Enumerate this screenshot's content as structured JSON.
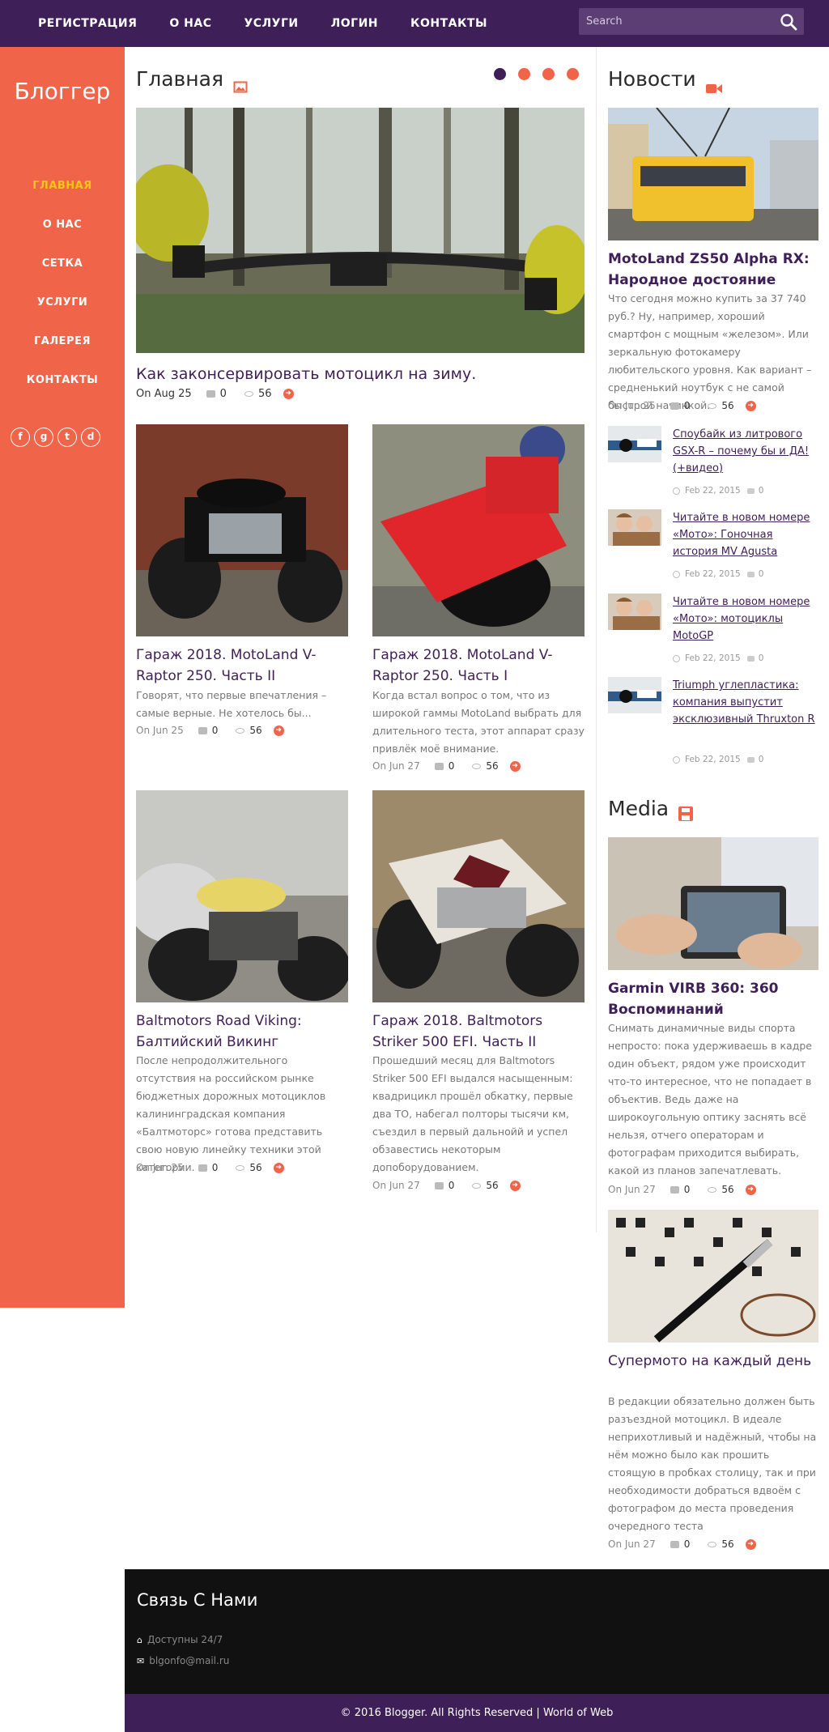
{
  "topnav": {
    "items": [
      {
        "label": "РЕГИСТРАЦИЯ"
      },
      {
        "label": "О НАС"
      },
      {
        "label": "УСЛУГИ"
      },
      {
        "label": "ЛОГИН"
      },
      {
        "label": "КОНТАКТЫ"
      }
    ],
    "search_placeholder": "Search"
  },
  "sidebar": {
    "logo": "Блоггер",
    "items": [
      {
        "label": "ГЛАВНАЯ"
      },
      {
        "label": "О НАС"
      },
      {
        "label": "СЕТКА"
      },
      {
        "label": "УСЛУГИ"
      },
      {
        "label": "ГАЛЕРЕЯ"
      },
      {
        "label": "КОНТАКТЫ"
      }
    ],
    "social": [
      "f",
      "g",
      "t",
      "d"
    ]
  },
  "main": {
    "title": "Главная",
    "featured": {
      "title": "Как законсервировать мотоцикл на зиму.",
      "date": "On Aug 25",
      "comments": "0",
      "views": "56"
    },
    "posts": [
      {
        "title": "Гараж 2018. MotoLand V-Raptor 250. Часть II",
        "excerpt": "Говорят, что первые впечатления – самые верные. Не хотелось бы...",
        "date": "On Jun 25",
        "comments": "0",
        "views": "56"
      },
      {
        "title": "Гараж 2018. MotoLand V-Raptor 250. Часть I",
        "excerpt": "Когда встал вопрос о том, что из широкой гаммы MotoLand выбрать для длительного теста, этот аппарат сразу привлёк моё внимание.",
        "date": "On Jun 27",
        "comments": "0",
        "views": "56"
      },
      {
        "title": "Baltmotors Road Viking: Балтийский Викинг",
        "excerpt": "После непродолжительного отсутствия на российском рынке бюджетных дорожных мотоциклов калининградская компания «Балтмоторс» готова представить свою новую линейку техники этой категории.",
        "date": "On Jun 25",
        "comments": "0",
        "views": "56"
      },
      {
        "title": "Гараж 2018. Baltmotors Striker 500 EFI. Часть II",
        "excerpt": "Прошедший месяц для Baltmotors Striker 500 EFI выдался насыщенным: квадрицикл прошёл обкатку, первые два ТО, набегал полторы тысячи км, съездил в первый дальнойй и успел обзавестись некоторым допоборудованием.",
        "date": "On Jun 27",
        "comments": "0",
        "views": "56"
      }
    ]
  },
  "news": {
    "title": "Новости",
    "lead": {
      "title": "MotoLand ZS50 Alpha RX: Народное достояние",
      "excerpt": "Что сегодня можно купить за 37 740 руб.? Ну, например, хороший смартфон с мощным «железом». Или зеркальную фотокамеру любительского уровня. Как вариант – средненький ноутбук с не самой быстрой начинкой.",
      "date": "On Jun 25",
      "comments": "0",
      "views": "56"
    },
    "items": [
      {
        "title": "Споубайк из литрового GSX-R – почему бы и ДА! (+видео)",
        "date": "Feb 22, 2015",
        "comments": "0"
      },
      {
        "title": "Читайте в новом номере «Мото»: Гоночная история MV Agusta",
        "date": "Feb 22, 2015",
        "comments": "0"
      },
      {
        "title": "Читайте в новом номере «Мото»: мотоциклы MotoGP",
        "date": "Feb 22, 2015",
        "comments": "0"
      },
      {
        "title": "Triumph углепластика: компания выпустит эксклюзивный Thruxton R",
        "date": "Feb 22, 2015",
        "comments": "0"
      }
    ]
  },
  "media": {
    "title": "Media",
    "items": [
      {
        "title": "Garmin VIRB 360: 360 Воспоминаний",
        "excerpt": "Снимать динамичные виды спорта непросто: пока удерживаешь в кадре один объект, рядом уже происходит что-то интересное, что не попадает в объектив. Ведь даже на широкоугольную оптику заснять всё нельзя, отчего операторам и фотографам приходится выбирать, какой из планов запечатлевать.",
        "date": "On Jun 27",
        "comments": "0",
        "views": "56"
      },
      {
        "title": "Супермото на каждый день",
        "excerpt": "В редакции обязательно должен быть разъездной мотоцикл. В идеале неприхотливый и надёжный, чтобы на нём можно было как прошить стоящую в пробках столицу, так и при необходимости добраться вдвоём с фотографом до места проведения очередного теста",
        "date": "On Jun 27",
        "comments": "0",
        "views": "56"
      }
    ]
  },
  "footer": {
    "title": "Связь С Нами",
    "hours": "Доступны 24/7",
    "email": "blgonfo@mail.ru",
    "copyright": "© 2016 Blogger. All Rights Reserved | World of Web"
  },
  "colors": {
    "purple": "#3f1f57",
    "orange": "#f0644a",
    "active": "#f5c518",
    "footer": "#111111"
  }
}
